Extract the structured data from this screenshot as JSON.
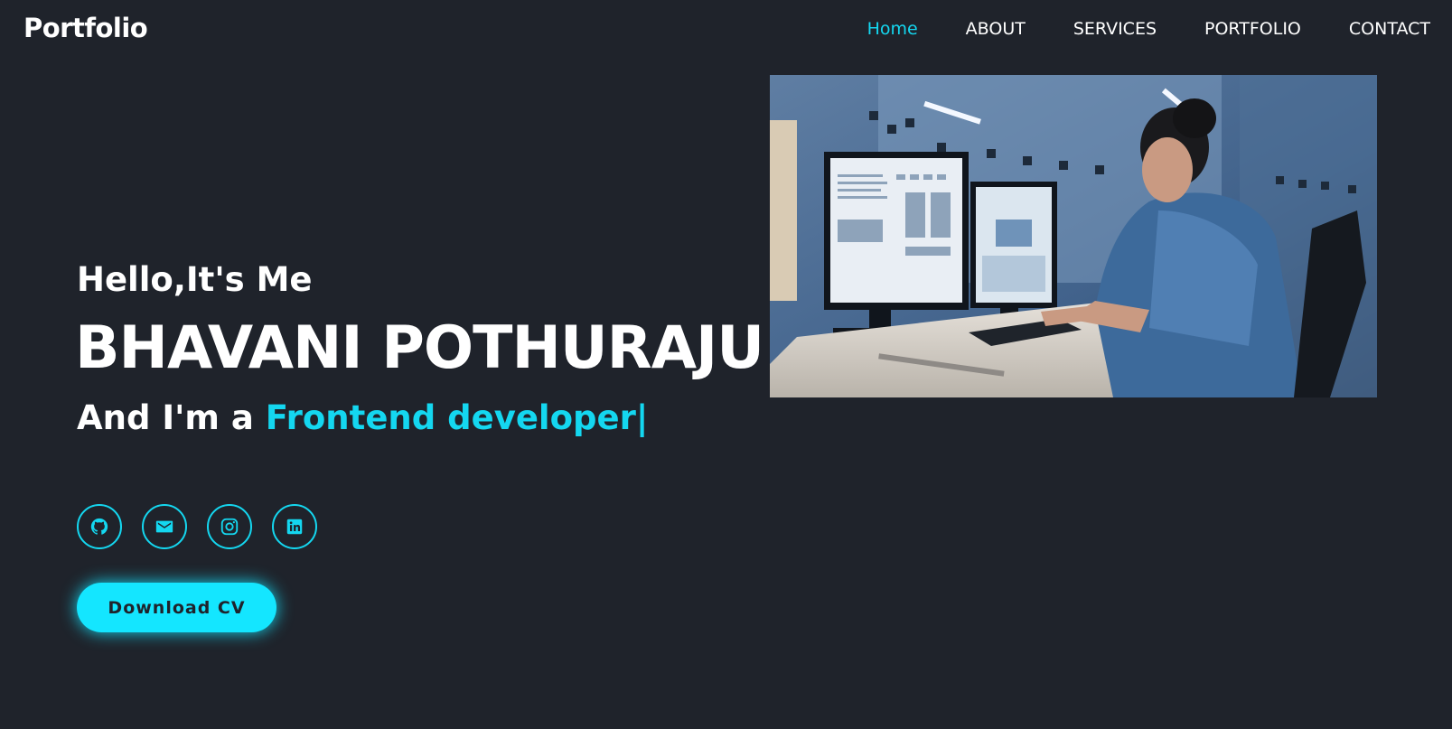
{
  "header": {
    "logo": "Portfolio",
    "nav": [
      {
        "label": "Home",
        "active": true
      },
      {
        "label": "ABOUT"
      },
      {
        "label": "SERVICES"
      },
      {
        "label": "PORTFOLIO"
      },
      {
        "label": "CONTACT"
      }
    ]
  },
  "hero": {
    "greeting": "Hello,It's Me",
    "name": "BHAVANI POTHURAJU",
    "role_prefix": "And I'm a ",
    "role_highlight": "Frontend developer",
    "cursor": "|",
    "download_label": "Download CV",
    "socials": [
      {
        "icon": "github-icon"
      },
      {
        "icon": "mail-icon"
      },
      {
        "icon": "instagram-icon"
      },
      {
        "icon": "linkedin-icon"
      }
    ]
  },
  "colors": {
    "background": "#1f232b",
    "accent": "#14d7f0",
    "button": "#14e6ff",
    "text": "#ffffff"
  }
}
